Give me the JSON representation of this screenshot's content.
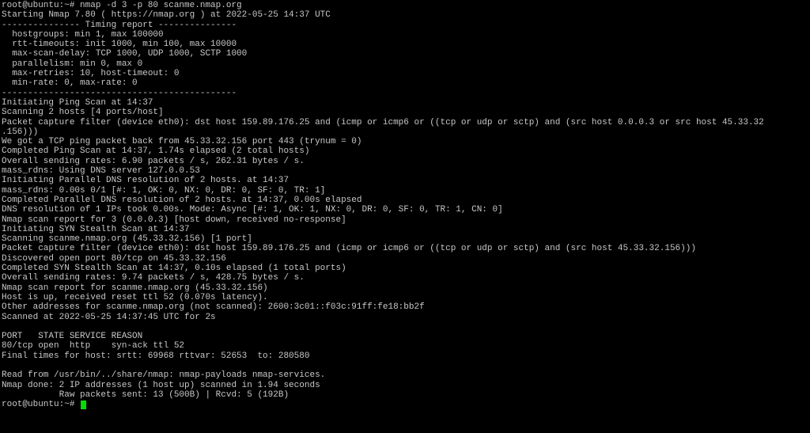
{
  "terminal": {
    "cursor_color": "#00e000",
    "text_color": "#c8c8c8",
    "background": "#000000",
    "prompt": "root@ubuntu:~# ",
    "lines": [
      "root@ubuntu:~# nmap -d 3 -p 80 scanme.nmap.org",
      "Starting Nmap 7.80 ( https://nmap.org ) at 2022-05-25 14:37 UTC",
      "--------------- Timing report ---------------",
      "  hostgroups: min 1, max 100000",
      "  rtt-timeouts: init 1000, min 100, max 10000",
      "  max-scan-delay: TCP 1000, UDP 1000, SCTP 1000",
      "  parallelism: min 0, max 0",
      "  max-retries: 10, host-timeout: 0",
      "  min-rate: 0, max-rate: 0",
      "---------------------------------------------",
      "Initiating Ping Scan at 14:37",
      "Scanning 2 hosts [4 ports/host]",
      "Packet capture filter (device eth0): dst host 159.89.176.25 and (icmp or icmp6 or ((tcp or udp or sctp) and (src host 0.0.0.3 or src host 45.33.32",
      ".156)))",
      "We got a TCP ping packet back from 45.33.32.156 port 443 (trynum = 0)",
      "Completed Ping Scan at 14:37, 1.74s elapsed (2 total hosts)",
      "Overall sending rates: 6.90 packets / s, 262.31 bytes / s.",
      "mass_rdns: Using DNS server 127.0.0.53",
      "Initiating Parallel DNS resolution of 2 hosts. at 14:37",
      "mass_rdns: 0.00s 0/1 [#: 1, OK: 0, NX: 0, DR: 0, SF: 0, TR: 1]",
      "Completed Parallel DNS resolution of 2 hosts. at 14:37, 0.00s elapsed",
      "DNS resolution of 1 IPs took 0.00s. Mode: Async [#: 1, OK: 1, NX: 0, DR: 0, SF: 0, TR: 1, CN: 0]",
      "Nmap scan report for 3 (0.0.0.3) [host down, received no-response]",
      "Initiating SYN Stealth Scan at 14:37",
      "Scanning scanme.nmap.org (45.33.32.156) [1 port]",
      "Packet capture filter (device eth0): dst host 159.89.176.25 and (icmp or icmp6 or ((tcp or udp or sctp) and (src host 45.33.32.156)))",
      "Discovered open port 80/tcp on 45.33.32.156",
      "Completed SYN Stealth Scan at 14:37, 0.10s elapsed (1 total ports)",
      "Overall sending rates: 9.74 packets / s, 428.75 bytes / s.",
      "Nmap scan report for scanme.nmap.org (45.33.32.156)",
      "Host is up, received reset ttl 52 (0.070s latency).",
      "Other addresses for scanme.nmap.org (not scanned): 2600:3c01::f03c:91ff:fe18:bb2f",
      "Scanned at 2022-05-25 14:37:45 UTC for 2s",
      "",
      "PORT   STATE SERVICE REASON",
      "80/tcp open  http    syn-ack ttl 52",
      "Final times for host: srtt: 69968 rttvar: 52653  to: 280580",
      "",
      "Read from /usr/bin/../share/nmap: nmap-payloads nmap-services.",
      "Nmap done: 2 IP addresses (1 host up) scanned in 1.94 seconds",
      "           Raw packets sent: 13 (500B) | Rcvd: 5 (192B)"
    ]
  }
}
